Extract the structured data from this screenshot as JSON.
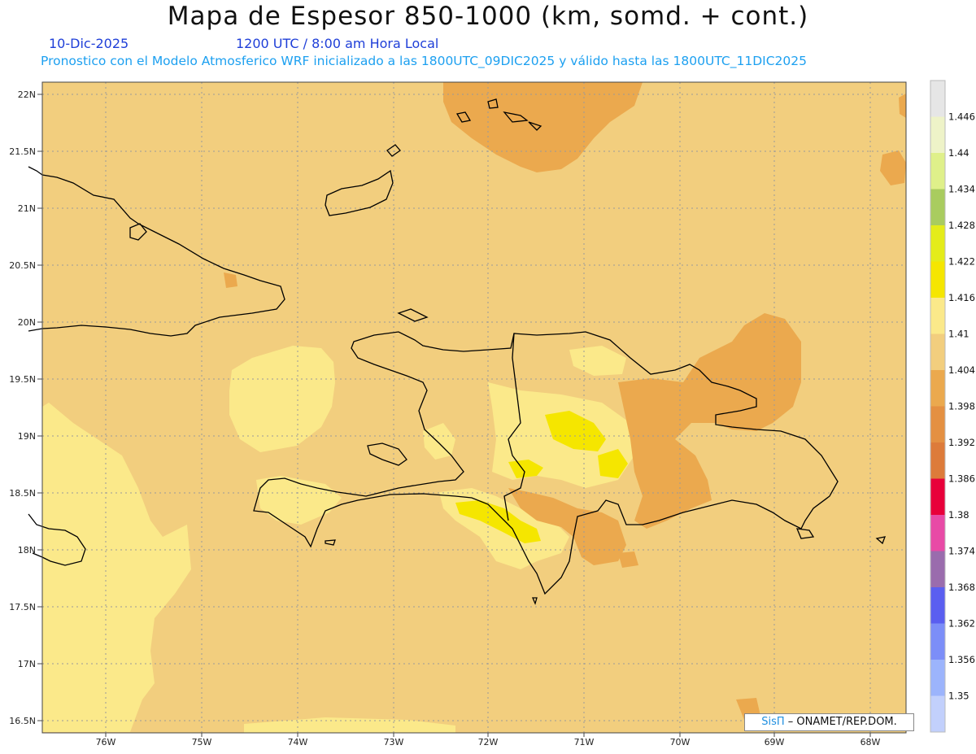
{
  "header": {
    "title": "Mapa de Espesor 850-1000 (km, somd. + cont.)",
    "date": "10-Dic-2025",
    "time": "1200 UTC / 8:00 am Hora Local",
    "forecast_note": "Pronostico con el Modelo Atmosferico WRF inicializado a las 1800UTC_09DIC2025 y válido hasta las  1800UTC_11DIC2025"
  },
  "colors": {
    "date_text": "#1f3fd8",
    "note_text": "#1da0f0",
    "background_field": "#f2ce7e",
    "coastline": "#000000"
  },
  "axes": {
    "lat_ticks": [
      "22N",
      "21.5N",
      "21N",
      "20.5N",
      "20N",
      "19.5N",
      "19N",
      "18.5N",
      "18N",
      "17.5N",
      "17N",
      "16.5N"
    ],
    "lon_ticks": [
      "76W",
      "75W",
      "74W",
      "73W",
      "72W",
      "71W",
      "70W",
      "69W",
      "68W"
    ],
    "grid": "dotted"
  },
  "colorbar": {
    "labels": [
      "1.446",
      "1.44",
      "1.434",
      "1.428",
      "1.422",
      "1.416",
      "1.41",
      "1.404",
      "1.398",
      "1.392",
      "1.386",
      "1.38",
      "1.374",
      "1.368",
      "1.362",
      "1.356",
      "1.35"
    ],
    "colors_top_to_bottom": [
      "#e6e6e6",
      "#eef3c8",
      "#dff08a",
      "#a9cc5f",
      "#e4ec1a",
      "#f5e600",
      "#fbe98a",
      "#f2ce7e",
      "#eba94e",
      "#e49042",
      "#dd7b3a",
      "#e8003a",
      "#e84aa6",
      "#9a6cad",
      "#5a5ef0",
      "#7c8ef8",
      "#9cb4fc",
      "#c2d0fc"
    ]
  },
  "credit": {
    "sis": "SisΠ",
    "org": " – ONAMET/REP.DOM."
  }
}
